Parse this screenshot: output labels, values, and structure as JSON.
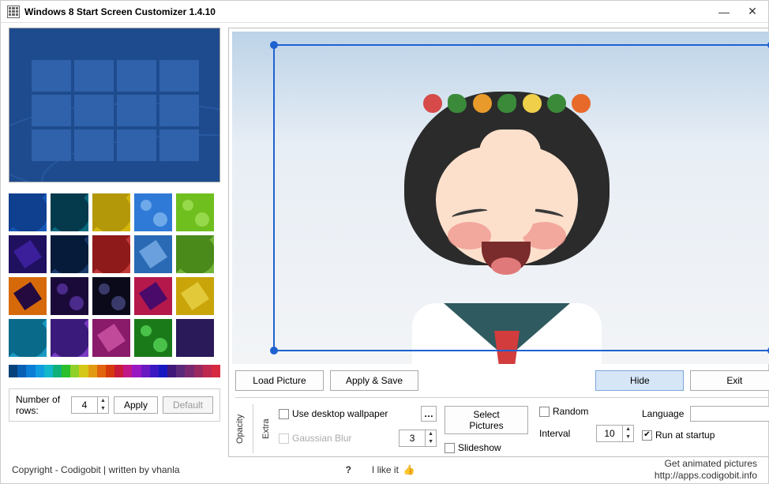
{
  "window": {
    "title": "Windows 8 Start Screen Customizer 1.4.10"
  },
  "left": {
    "rows_label": "Number of rows:",
    "rows_value": "4",
    "apply": "Apply",
    "default": "Default",
    "color_strip": [
      "#08427a",
      "#0860b5",
      "#0a7dd6",
      "#109de0",
      "#12b7c9",
      "#10b07a",
      "#2bbf2b",
      "#8fd12a",
      "#d6c816",
      "#e29a12",
      "#e2640e",
      "#d6390e",
      "#c91a3a",
      "#c21887",
      "#9a18c2",
      "#6a18c2",
      "#3c18c2",
      "#1818c2",
      "#40187a",
      "#5a297a",
      "#7a2970",
      "#9a2960",
      "#bf2950",
      "#d62940"
    ],
    "thumbs": [
      {
        "bg": "#0f3f8f",
        "shape": "swirl",
        "c": "#1557b5"
      },
      {
        "bg": "#043a4c",
        "shape": "swirl",
        "c": "#0a6a7e"
      },
      {
        "bg": "#b3990a",
        "shape": "swirl",
        "c": "#d6b80d"
      },
      {
        "bg": "#2f7ad6",
        "shape": "dots",
        "c": "#6ea9ea"
      },
      {
        "bg": "#6fbf1e",
        "shape": "dots",
        "c": "#96d94a"
      },
      {
        "bg": "#201060",
        "shape": "geo",
        "c": "#3a1e9a"
      },
      {
        "bg": "#061a3a",
        "shape": "swirl",
        "c": "#1a3a6a"
      },
      {
        "bg": "#8f1a1a",
        "shape": "swirl",
        "c": "#c23a3a"
      },
      {
        "bg": "#2a6ab5",
        "shape": "geo",
        "c": "#6aa0dd"
      },
      {
        "bg": "#4a8a1a",
        "shape": "swirl",
        "c": "#72b53a"
      },
      {
        "bg": "#d66a0a",
        "shape": "geo",
        "c": "#250a40"
      },
      {
        "bg": "#1a0a3a",
        "shape": "dots",
        "c": "#4a2a8a"
      },
      {
        "bg": "#0a0a1a",
        "shape": "dots",
        "c": "#3a3a6a"
      },
      {
        "bg": "#b5184a",
        "shape": "geo",
        "c": "#4a0a6a"
      },
      {
        "bg": "#c9a50a",
        "shape": "geo",
        "c": "#e2c93a"
      },
      {
        "bg": "#0a6a8a",
        "shape": "swirl",
        "c": "#1a9ac2"
      },
      {
        "bg": "#3a1a7a",
        "shape": "swirl",
        "c": "#7a3ac2"
      },
      {
        "bg": "#8a1a6a",
        "shape": "geo",
        "c": "#c24a9a"
      },
      {
        "bg": "#1a7a1a",
        "shape": "dots",
        "c": "#4ac24a"
      },
      {
        "bg": "#2a1a5a",
        "shape": "",
        "c": "#2a1a5a"
      }
    ]
  },
  "right": {
    "buttons": {
      "load": "Load Picture",
      "apply_save": "Apply & Save",
      "hide": "Hide",
      "exit": "Exit"
    },
    "opacity_label": "Opacity",
    "extra_label": "Extra",
    "use_desktop": "Use desktop wallpaper",
    "gaussian": "Gaussian Blur",
    "gaussian_value": "3",
    "select_pictures": "Select Pictures",
    "slideshow": "Slideshow",
    "random": "Random",
    "interval_label": "Interval",
    "interval_value": "10",
    "language_label": "Language",
    "language_value": "",
    "run_startup": "Run at startup",
    "run_startup_checked": true
  },
  "footer": {
    "copyright": "Copyright - Codigobit | written by vhanla",
    "help": "?",
    "like": "I like it",
    "link1": "Get animated pictures",
    "link2": "http://apps.codigobit.info"
  }
}
